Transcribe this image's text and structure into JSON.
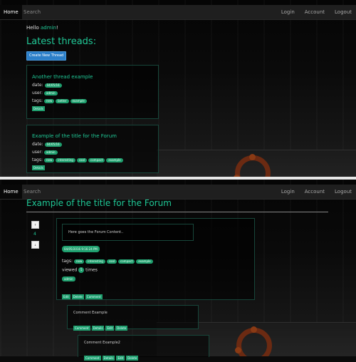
{
  "nav": {
    "home": "Home",
    "search": "Search",
    "login": "Login",
    "account": "Account",
    "logout": "Logout"
  },
  "home": {
    "hello_prefix": "Hello ",
    "hello_user": "admin",
    "hello_suffix": "!",
    "heading": "Latest threads:",
    "create_button": "Create New Thread",
    "threads": [
      {
        "title": "Another thread example",
        "date_label": "date:",
        "date": "04/05/16",
        "user_label": "user:",
        "user": "admin",
        "tags_label": "tags:",
        "tags": [
          "new",
          "better",
          "example"
        ],
        "details": "Details"
      },
      {
        "title": "Example of the title for the Forum",
        "date_label": "date:",
        "date": "04/05/16",
        "user_label": "user:",
        "user": "admin",
        "tags_label": "tags:",
        "tags": [
          "new",
          "interesting",
          "cool",
          "compact",
          "example"
        ],
        "details": "Details"
      }
    ]
  },
  "thread": {
    "title": "Example of the title for the Forum",
    "vote_count": "4",
    "vote_up": "↑",
    "vote_down": "↓",
    "content": "Here goes the Forum Content..",
    "date": "04/05/2016 9:16:24 PM",
    "tags_label": "tags:",
    "tags": [
      "new",
      "interesting",
      "cool",
      "compact",
      "example"
    ],
    "views_label": "viewed",
    "views": "5",
    "views_suffix": "times",
    "author": "admin",
    "actions": [
      "Edit",
      "Delete",
      "Comment"
    ],
    "comments": [
      {
        "title": "Comment Example",
        "actions": [
          "Comment",
          "Details",
          "Edit",
          "Delete"
        ]
      },
      {
        "title": "Comment Example2",
        "actions": [
          "Comment",
          "Details",
          "Edit",
          "Delete"
        ]
      }
    ]
  }
}
